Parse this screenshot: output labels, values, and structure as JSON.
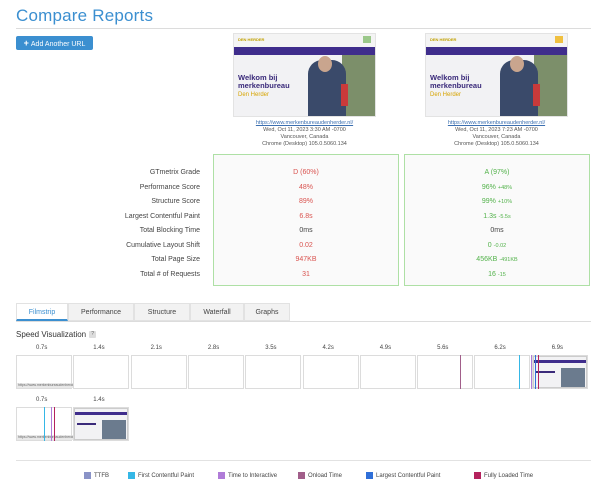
{
  "page": {
    "title": "Compare Reports",
    "add_button": "Add Another URL"
  },
  "reports": [
    {
      "url": "https://www.merkenbureaudenherder.nl/",
      "date": "Wed, Oct 11, 2023 3:30 AM -0700",
      "location": "Vancouver, Canada",
      "browser": "Chrome (Desktop) 105.0.5060.134",
      "thumb": {
        "logo": "DEN HERDER",
        "h1a": "Welkom bij",
        "h1b": "merkenbureau",
        "h2": "Den Herder"
      },
      "grade": "D (60%)",
      "performance": "48%",
      "structure": "89%",
      "lcp": "6.8s",
      "tbt": "0ms",
      "cls": "0.02",
      "size": "947KB",
      "requests": "31"
    },
    {
      "url": "https://www.merkenbureaudenherder.nl/",
      "date": "Wed, Oct 11, 2023 7:23 AM -0700",
      "location": "Vancouver, Canada",
      "browser": "Chrome (Desktop) 105.0.5060.134",
      "thumb": {
        "logo": "DEN HERDER",
        "h1a": "Welkom bij",
        "h1b": "merkenbureau",
        "h2": "Den Herder"
      },
      "grade": "A (97%)",
      "performance": "96%",
      "performance_delta": "+48%",
      "structure": "99%",
      "structure_delta": "+10%",
      "lcp": "1.3s",
      "lcp_delta": "-5.5s",
      "tbt": "0ms",
      "cls": "0",
      "cls_delta": "-0.02",
      "size": "456KB",
      "size_delta": "-491KB",
      "requests": "16",
      "requests_delta": "-15"
    }
  ],
  "metric_labels": {
    "grade": "GTmetrix Grade",
    "performance": "Performance Score",
    "structure": "Structure Score",
    "lcp": "Largest Contentful Paint",
    "tbt": "Total Blocking Time",
    "cls": "Cumulative Layout Shift",
    "size": "Total Page Size",
    "requests": "Total # of Requests"
  },
  "tabs": [
    "Filmstrip",
    "Performance",
    "Structure",
    "Waterfall",
    "Graphs"
  ],
  "active_tab": "Filmstrip",
  "speed_viz": {
    "title": "Speed Visualization",
    "help": "?"
  },
  "strip1_ticks": [
    "0.7s",
    "1.4s",
    "2.1s",
    "2.8s",
    "3.5s",
    "4.2s",
    "4.9s",
    "5.6s",
    "6.2s",
    "6.9s"
  ],
  "strip2_ticks": [
    "0.7s",
    "1.4s"
  ],
  "strip_url": "https://www.merkenbureaudenherder.nl/",
  "legend": [
    {
      "label": "TTFB",
      "color": "#8a93c7"
    },
    {
      "label": "First Contentful Paint",
      "color": "#35b7e6"
    },
    {
      "label": "Time to Interactive",
      "color": "#b07cd8"
    },
    {
      "label": "Onload Time",
      "color": "#a15e8a"
    },
    {
      "label": "Largest Contentful Paint",
      "color": "#2f6fd8"
    },
    {
      "label": "Fully Loaded Time",
      "color": "#b5225d"
    }
  ]
}
